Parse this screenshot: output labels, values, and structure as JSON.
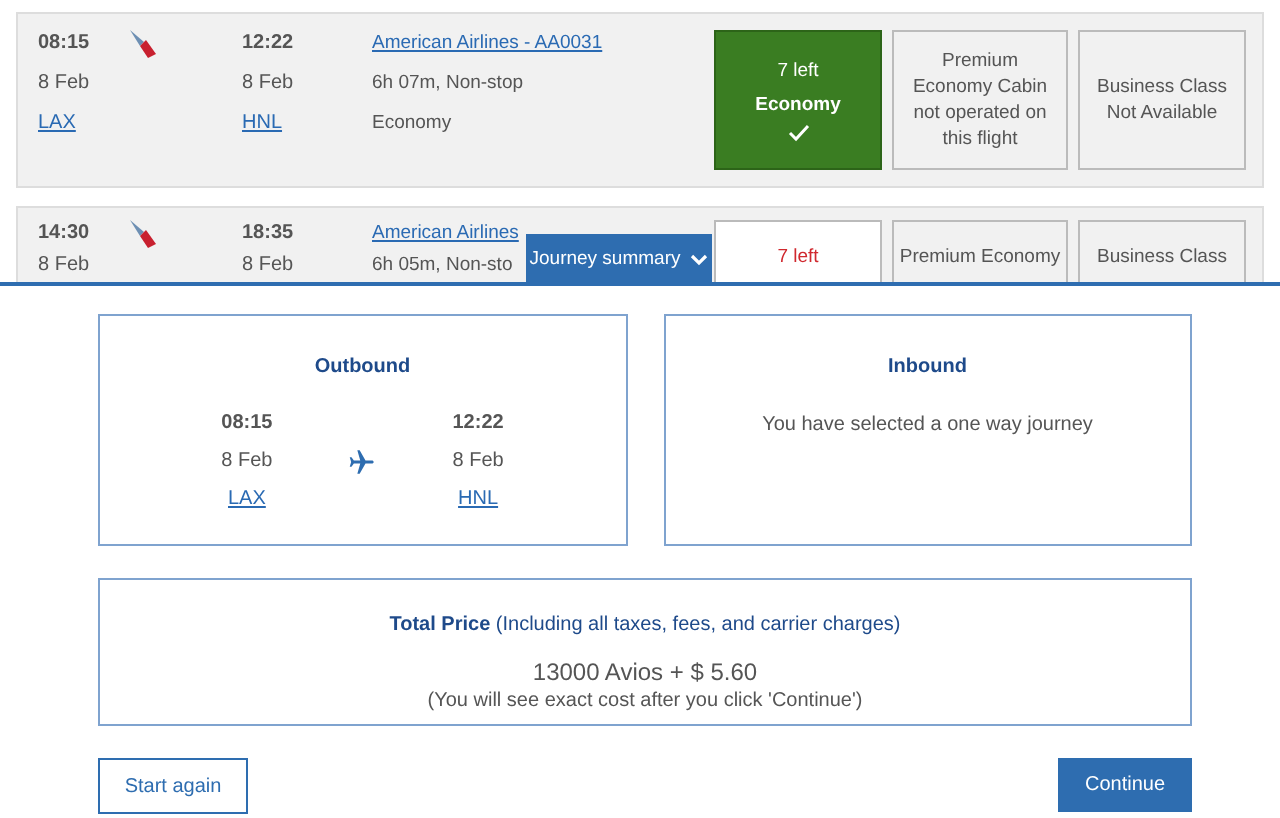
{
  "flights": [
    {
      "departure": {
        "time": "08:15",
        "date": "8 Feb",
        "airport": "LAX"
      },
      "arrival": {
        "time": "12:22",
        "date": "8 Feb",
        "airport": "HNL"
      },
      "flight": "American Airlines - AA0031",
      "duration": "6h 07m, Non-stop",
      "cabin": "Economy",
      "fares": [
        {
          "kind": "available",
          "selected": true,
          "seats": "7 left",
          "label": "Economy"
        },
        {
          "kind": "unavailable",
          "text": "Premium Economy Cabin not operated on this flight"
        },
        {
          "kind": "unavailable",
          "text": "Business Class Not Available"
        }
      ]
    },
    {
      "departure": {
        "time": "14:30",
        "date": "8 Feb"
      },
      "arrival": {
        "time": "18:35",
        "date": "8 Feb"
      },
      "flight": "American Airlines",
      "duration": "6h 05m, Non-sto",
      "fares": [
        {
          "kind": "available",
          "selected": false,
          "seats": "7 left"
        },
        {
          "kind": "unavailable",
          "text": "Premium Economy"
        },
        {
          "kind": "unavailable",
          "text": "Business Class"
        }
      ]
    }
  ],
  "summary": {
    "tab": {
      "label": "Journey summary",
      "expanded": true
    },
    "outbound": {
      "title": "Outbound",
      "departure": {
        "time": "08:15",
        "date": "8 Feb",
        "airport": "LAX"
      },
      "arrival": {
        "time": "12:22",
        "date": "8 Feb",
        "airport": "HNL"
      }
    },
    "inbound": {
      "title": "Inbound",
      "message": "You have selected a one way journey"
    },
    "price": {
      "heading": "**Total Price** (Including all taxes, fees, and carrier charges)",
      "amount": "13000 Avios + $ 5.60",
      "note": "(You will see exact cost after you click 'Continue')"
    },
    "buttons": [
      {
        "label": "Start again",
        "kind": "secondary"
      },
      {
        "label": "Continue",
        "kind": "primary"
      }
    ]
  }
}
